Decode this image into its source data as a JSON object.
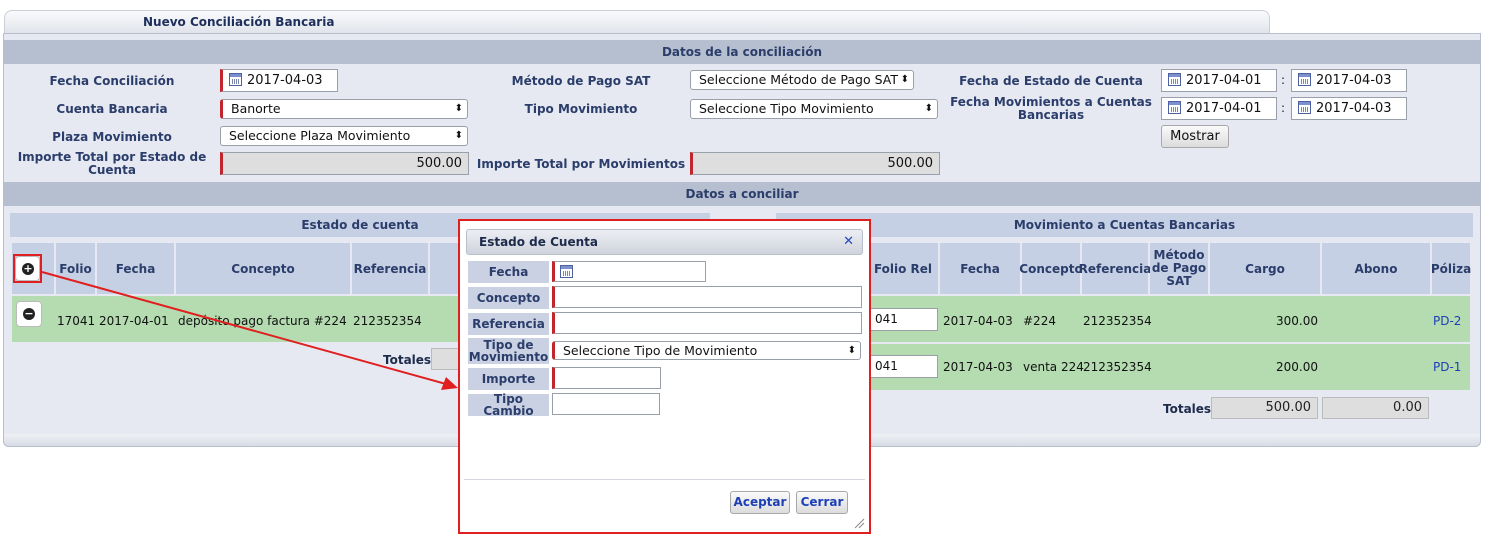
{
  "tab_title": "Nuevo Conciliación Bancaria",
  "datos_conciliacion": {
    "header": "Datos de la conciliación",
    "fecha_conciliacion": {
      "label": "Fecha Conciliación",
      "value": "2017-04-03"
    },
    "cuenta_bancaria": {
      "label": "Cuenta Bancaria",
      "value": "Banorte"
    },
    "plaza_movimiento": {
      "label": "Plaza Movimiento",
      "value": "Seleccione Plaza Movimiento"
    },
    "importe_estado": {
      "label": "Importe Total por Estado de Cuenta",
      "value": "500.00"
    },
    "metodo_pago": {
      "label": "Método de Pago SAT",
      "value": "Seleccione Método de Pago SAT"
    },
    "tipo_movimiento": {
      "label": "Tipo Movimiento",
      "value": "Seleccione Tipo Movimiento"
    },
    "importe_movimientos": {
      "label": "Importe Total por Movimientos",
      "value": "500.00"
    },
    "fecha_estado": {
      "label": "Fecha de Estado de Cuenta",
      "from": "2017-04-01",
      "to": "2017-04-03"
    },
    "fecha_movimientos": {
      "label": "Fecha Movimientos a Cuentas Bancarias",
      "from": "2017-04-01",
      "to": "2017-04-03"
    },
    "separator": ":",
    "mostrar_label": "Mostrar"
  },
  "datos_a_conciliar": {
    "header": "Datos a conciliar",
    "estado_cuenta": {
      "header": "Estado de cuenta",
      "columns": [
        "Folio",
        "Fecha",
        "Concepto",
        "Referencia"
      ],
      "rows": [
        {
          "folio": "17041",
          "fecha": "2017-04-01",
          "concepto": "depósito pago factura #224",
          "referencia": "212352354"
        }
      ],
      "totales_label": "Totales"
    },
    "movimientos": {
      "header": "Movimiento a Cuentas Bancarias",
      "columns": [
        "Folio Rel",
        "Fecha",
        "Concepto",
        "Referencia",
        "Método de Pago SAT",
        "Cargo",
        "Abono",
        "Póliza"
      ],
      "rows": [
        {
          "folio_rel": "041",
          "fecha": "2017-04-03",
          "concepto": "#224",
          "referencia": "212352354",
          "cargo": "300.00",
          "abono": "",
          "poliza": "PD-2"
        },
        {
          "folio_rel": "041",
          "fecha": "2017-04-03",
          "concepto": "venta 224",
          "referencia": "212352354",
          "cargo": "200.00",
          "abono": "",
          "poliza": "PD-1"
        }
      ],
      "totales_label": "Totales",
      "total_cargo": "500.00",
      "total_abono": "0.00"
    }
  },
  "modal": {
    "title": "Estado de Cuenta",
    "close_glyph": "✕",
    "fecha_label": "Fecha",
    "fecha_value": "",
    "concepto_label": "Concepto",
    "referencia_label": "Referencia",
    "tipo_label": "Tipo de Movimiento",
    "tipo_value": "Seleccione Tipo de Movimiento",
    "importe_label": "Importe",
    "tipo_cambio_label": "Tipo Cambio",
    "aceptar_label": "Aceptar",
    "cerrar_label": "Cerrar"
  },
  "icons": {
    "add": "plus-circle-icon",
    "remove": "minus-circle-icon",
    "calendar": "calendar-icon"
  },
  "colors": {
    "highlight": "#e02020",
    "row_green": "#b4dcb0",
    "header_blue": "#b6bfcf",
    "link": "#1d3fb5"
  }
}
